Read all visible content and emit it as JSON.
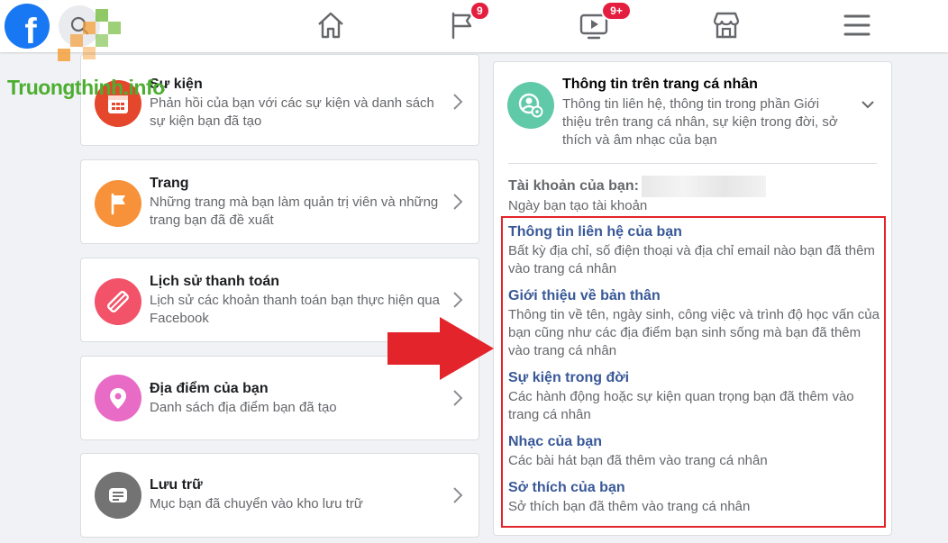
{
  "topbar": {
    "notification_badge": "9",
    "watch_badge": "9+"
  },
  "watermark": {
    "text": "Truongthinh.info"
  },
  "left_items": [
    {
      "title": "Sự kiện",
      "desc": "Phản hồi của bạn với các sự kiện và danh sách sự kiện bạn đã tạo",
      "icon": "calendar-icon",
      "color": "#e4472b"
    },
    {
      "title": "Trang",
      "desc": "Những trang mà bạn làm quản trị viên và những trang bạn đã đề xuất",
      "icon": "flag-icon",
      "color": "#f7923a"
    },
    {
      "title": "Lịch sử thanh toán",
      "desc": "Lịch sử các khoản thanh toán bạn thực hiện qua Facebook",
      "icon": "payment-icon",
      "color": "#f35369"
    },
    {
      "title": "Địa điểm của bạn",
      "desc": "Danh sách địa điểm bạn đã tạo",
      "icon": "location-pin-icon",
      "color": "#e86bc5"
    },
    {
      "title": "Lưu trữ",
      "desc": "Mục bạn đã chuyển vào kho lưu trữ",
      "icon": "archive-icon",
      "color": "#737373"
    }
  ],
  "profile_section": {
    "title": "Thông tin trên trang cá nhân",
    "desc": "Thông tin liên hệ, thông tin trong phần Giới thiệu trên trang cá nhân, sự kiện trong đời, sở thích và âm nhạc của bạn",
    "account_label": "Tài khoản của bạn:",
    "account_sub": "Ngày bạn tạo tài khoản",
    "items": [
      {
        "title": "Thông tin liên hệ của bạn",
        "desc": "Bất kỳ địa chỉ, số điện thoại và địa chỉ email nào bạn đã thêm vào trang cá nhân"
      },
      {
        "title": "Giới thiệu về bản thân",
        "desc": "Thông tin về tên, ngày sinh, công việc và trình độ học vấn của bạn cũng như các địa điểm bạn sinh sống mà bạn đã thêm vào trang cá nhân"
      },
      {
        "title": "Sự kiện trong đời",
        "desc": "Các hành động hoặc sự kiện quan trọng bạn đã thêm vào trang cá nhân"
      },
      {
        "title": "Nhạc của bạn",
        "desc": "Các bài hát bạn đã thêm vào trang cá nhân"
      },
      {
        "title": "Sở thích của bạn",
        "desc": "Sở thích bạn đã thêm vào trang cá nhân"
      }
    ]
  },
  "colors": {
    "facebook_blue": "#1877f2",
    "link_blue": "#385898",
    "highlight_red": "#e3242b",
    "badge_red": "#e41e3f"
  }
}
